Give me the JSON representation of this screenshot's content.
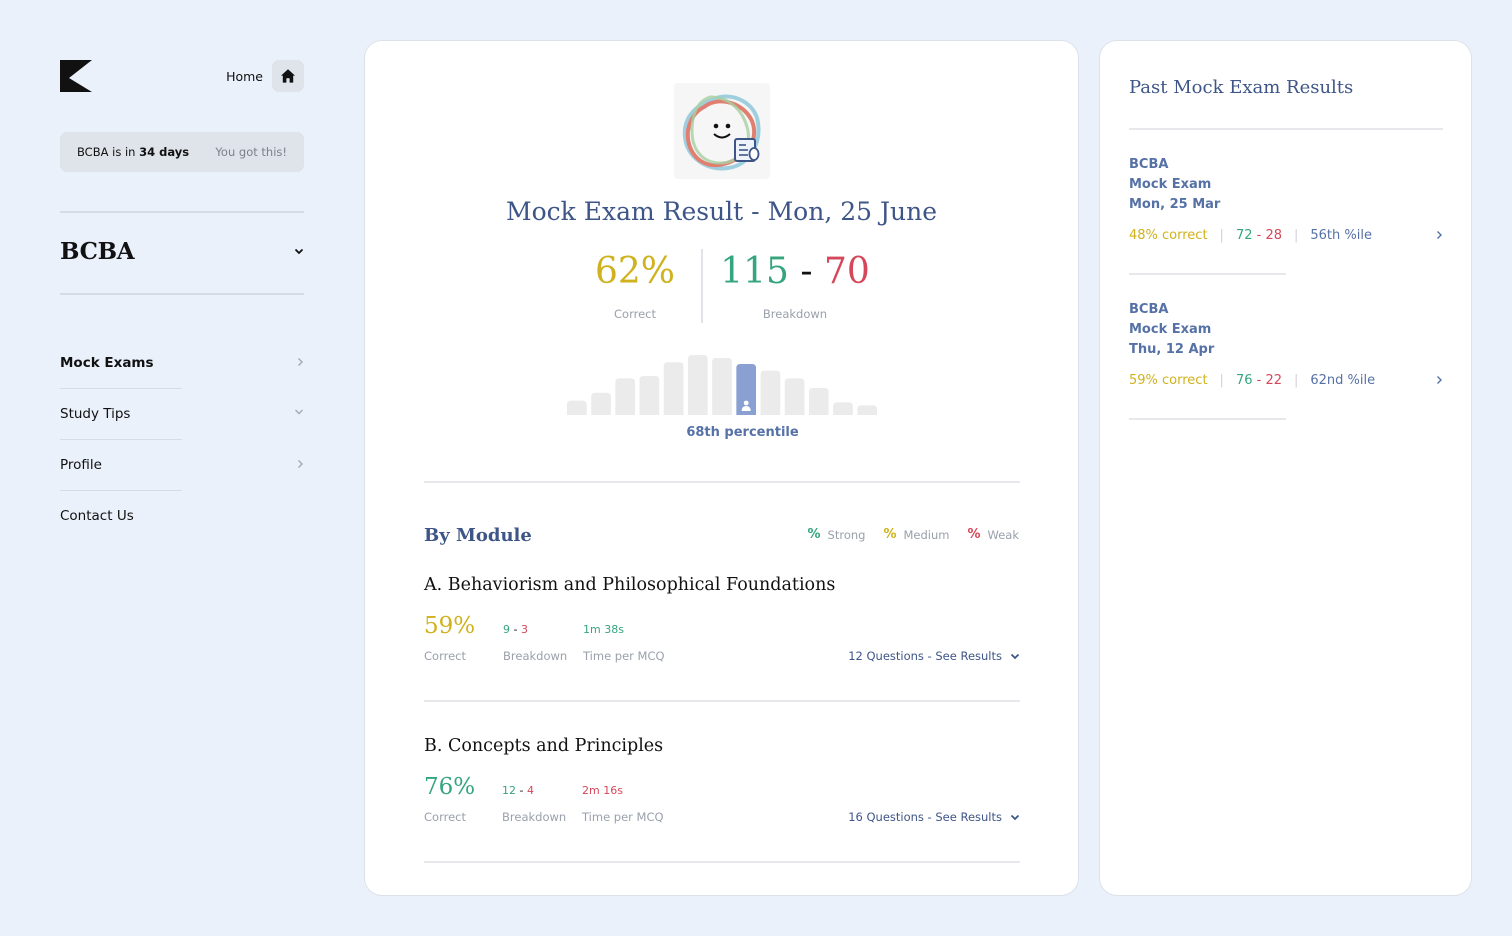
{
  "sidebar": {
    "home_label": "Home",
    "countdown": {
      "prefix": "BCBA is in",
      "days": "34 days",
      "motto": "You got this!"
    },
    "course": "BCBA",
    "nav": [
      {
        "label": "Mock Exams",
        "active": true,
        "chevron": "chevron-right-icon"
      },
      {
        "label": "Study Tips",
        "active": false,
        "chevron": "chevron-down-icon"
      },
      {
        "label": "Profile",
        "active": false,
        "chevron": "chevron-right-icon"
      },
      {
        "label": "Contact Us",
        "active": false,
        "chevron": ""
      }
    ]
  },
  "main": {
    "title": "Mock Exam Result - Mon, 25 June",
    "correct_pct": "62%",
    "correct_label": "Correct",
    "breakdown_right": "115",
    "breakdown_sep": " - ",
    "breakdown_wrong": "70",
    "breakdown_label": "Breakdown",
    "percentile_text": "68th percentile",
    "distribution": {
      "relative_heights": [
        0.24,
        0.37,
        0.61,
        0.65,
        0.88,
        1.0,
        0.95,
        0.85,
        0.74,
        0.61,
        0.45,
        0.21,
        0.16
      ],
      "highlight_index": 7
    },
    "by_module_title": "By Module",
    "legend": [
      {
        "symbol": "%",
        "label": "Strong",
        "color": "#35a57e"
      },
      {
        "symbol": "%",
        "label": "Medium",
        "color": "#cfb21d"
      },
      {
        "symbol": "%",
        "label": "Weak",
        "color": "#d5485a"
      }
    ],
    "modules": [
      {
        "title": "A. Behaviorism and Philosophical Foundations",
        "pct": "59%",
        "pct_label": "Correct",
        "right": "9",
        "sep": " - ",
        "wrong": "3",
        "breakdown_label": "Breakdown",
        "time": "1m 38s",
        "time_label": "Time per MCQ",
        "link": "12 Questions - See Results"
      },
      {
        "title": "B. Concepts and Principles",
        "pct": "76%",
        "pct_label": "Correct",
        "right": "12",
        "sep": " - ",
        "wrong": "4",
        "breakdown_label": "Breakdown",
        "time": "2m 16s",
        "time_label": "Time per MCQ",
        "link": "16 Questions - See Results"
      }
    ]
  },
  "past": {
    "title": "Past Mock Exam Results",
    "items": [
      {
        "course": "BCBA",
        "name": "Mock Exam",
        "date": "Mon, 25 Mar",
        "correct": "48% correct",
        "right": "72",
        "sep": " - ",
        "wrong": "28",
        "percentile": "56th %ile"
      },
      {
        "course": "BCBA",
        "name": "Mock Exam",
        "date": "Thu, 12 Apr",
        "correct": "59% correct",
        "right": "76",
        "sep": " - ",
        "wrong": "22",
        "percentile": "62nd %ile"
      }
    ]
  },
  "colors": {
    "background": "#ebf1fb",
    "accent_blue": "#3e5587",
    "strong_green": "#35a57e",
    "medium_yellow": "#cfb21d",
    "weak_red": "#d5485a",
    "bar_grey": "#ebebeb",
    "bar_highlight": "#8a9fd2"
  }
}
